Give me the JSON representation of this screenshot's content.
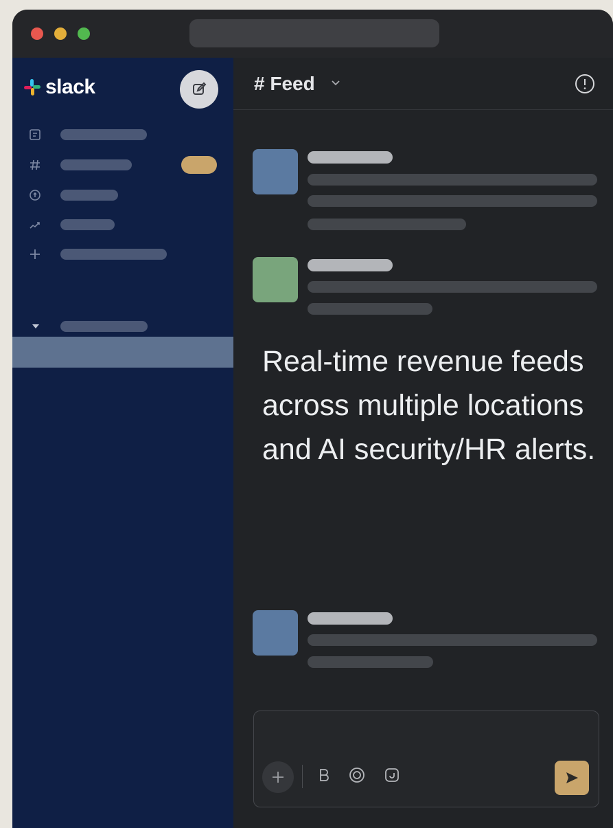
{
  "window": {
    "traffic_lights": {
      "close": "#e8584f",
      "minimize": "#e3ae3a",
      "maximize": "#52b94f"
    }
  },
  "sidebar": {
    "brand": "slack",
    "background": "#0f1f45",
    "compose_icon": "compose-icon",
    "nav_icons": [
      "threads-icon",
      "channels-icon",
      "activity-icon",
      "analytics-icon",
      "add-icon"
    ],
    "section_icon": "caret-down-icon",
    "badge_color": "#c9a56b",
    "selected_color": "#5e7290"
  },
  "channel": {
    "name": "# Feed",
    "info_icon": "info-icon"
  },
  "messages": [
    {
      "avatar_color": "#5b7aa1"
    },
    {
      "avatar_color": "#79a57c"
    },
    {
      "avatar_color": "#5b7aa1"
    }
  ],
  "overlay": {
    "text": "Real-time revenue feeds across multiple locations and AI security/HR alerts."
  },
  "composer": {
    "tools": [
      "plus-icon",
      "bold-icon",
      "emoji-icon",
      "attach-icon"
    ],
    "send_icon": "send-icon",
    "send_color": "#c9a56b"
  }
}
